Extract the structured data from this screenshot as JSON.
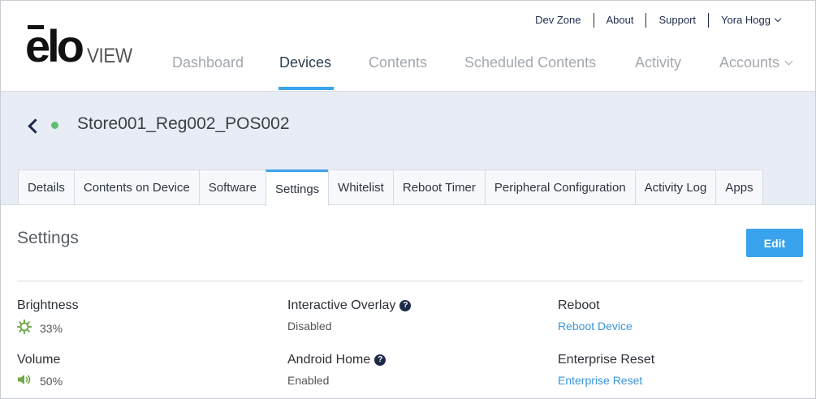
{
  "brand": {
    "logo_main": "ēlo",
    "logo_sub": "VIEW"
  },
  "util_nav": {
    "dev_zone": "Dev Zone",
    "about": "About",
    "support": "Support",
    "user_name": "Yora Hogg"
  },
  "main_nav": {
    "dashboard": "Dashboard",
    "devices": "Devices",
    "contents": "Contents",
    "scheduled_contents": "Scheduled Contents",
    "activity": "Activity",
    "accounts": "Accounts",
    "active": "Devices"
  },
  "device": {
    "name": "Store001_Reg002_POS002",
    "status_color": "#5fbf74"
  },
  "tabs": [
    {
      "label": "Details"
    },
    {
      "label": "Contents on Device"
    },
    {
      "label": "Software"
    },
    {
      "label": "Settings"
    },
    {
      "label": "Whitelist"
    },
    {
      "label": "Reboot Timer"
    },
    {
      "label": "Peripheral Configuration"
    },
    {
      "label": "Activity Log"
    },
    {
      "label": "Apps"
    }
  ],
  "active_tab": "Settings",
  "settings": {
    "title": "Settings",
    "edit_label": "Edit",
    "brightness": {
      "label": "Brightness",
      "value": "33%",
      "icon": "sun-icon"
    },
    "volume": {
      "label": "Volume",
      "value": "50%",
      "icon": "speaker-icon"
    },
    "interactive_overlay": {
      "label": "Interactive Overlay",
      "value": "Disabled"
    },
    "android_home": {
      "label": "Android Home",
      "value": "Enabled"
    },
    "reboot": {
      "label": "Reboot",
      "link": "Reboot Device"
    },
    "enterprise_reset": {
      "label": "Enterprise Reset",
      "link": "Enterprise Reset"
    }
  },
  "colors": {
    "accent": "#3aa3ed",
    "navy": "#1d2b4a",
    "icon_green": "#6fa84a",
    "link": "#3a95d9"
  }
}
